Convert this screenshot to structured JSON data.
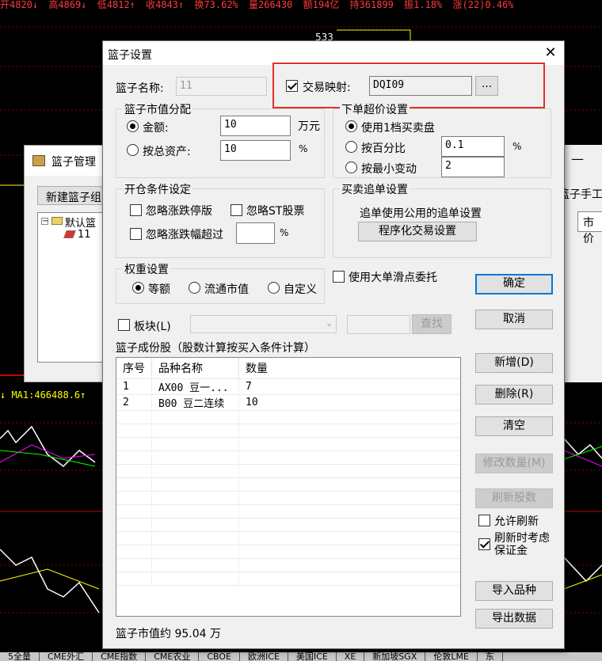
{
  "background": {
    "topbar": [
      "开4820↓",
      "高4869↓",
      "低4812↑",
      "收4843↑",
      "换73.62%",
      "量266430",
      "额194亿",
      "持361899",
      "振1.18%",
      "涨(22)0.46%"
    ],
    "price_label": "533",
    "ma_label": "↓ MA1:466488.6↑",
    "bottom_tabs": [
      "5全量",
      "CME外汇",
      "CME指数",
      "CME农业",
      "CBOE",
      "欧洲ICE",
      "美国ICE",
      "XE",
      "新加坡SGX",
      "伦敦LME",
      "东"
    ]
  },
  "basket_manager": {
    "title": "篮子管理",
    "new_button": "新建篮子组",
    "tree_root": "默认篮",
    "tree_child": "11",
    "right_label": "篮子手工",
    "right_box": "市价"
  },
  "dialog": {
    "title": "篮子设置",
    "name_label": "篮子名称:",
    "name_value": "11",
    "trade_map_label": "交易映射:",
    "trade_map_value": "DQI09",
    "ellipsis": "...",
    "market_value_group": "篮子市值分配",
    "amount_label": "金额:",
    "amount_value": "10",
    "amount_unit": "万元",
    "total_assets_label": "按总资产:",
    "total_assets_value": "10",
    "percent_unit": "%",
    "overprice_group": "下单超价设置",
    "opt_level1": "使用1档买卖盘",
    "opt_percent": "按百分比",
    "opt_percent_value": "0.1",
    "opt_min_tick": "按最小变动",
    "opt_min_tick_value": "2",
    "open_cond_group": "开仓条件设定",
    "ignore_limit": "忽略涨跌停版",
    "ignore_st": "忽略ST股票",
    "ignore_range": "忽略涨跌幅超过",
    "range_unit": "%",
    "chase_group": "买卖追单设置",
    "chase_desc": "追单使用公用的追单设置",
    "program_button": "程序化交易设置",
    "weight_group": "权重设置",
    "weight_equal": "等额",
    "weight_float": "流通市值",
    "weight_custom": "自定义",
    "big_slip": "使用大单滑点委托",
    "ok": "确定",
    "cancel": "取消",
    "sector_label": "板块(L)",
    "search": "查找",
    "components_label": "篮子成份股（股数计算按买入条件计算）",
    "table_headers": [
      "序号",
      "品种名称",
      "数量"
    ],
    "table_rows": [
      [
        "1",
        "AX00 豆一...",
        "7"
      ],
      [
        "2",
        "B00 豆二连续",
        "10"
      ]
    ],
    "add": "新增(D)",
    "delete": "删除(R)",
    "clear": "清空",
    "modify_qty": "修改数量(M)",
    "refresh_stock": "刷新股数",
    "allow_refresh": "允许刷新",
    "refresh_margin": "刷新时考虑保证金",
    "import": "导入品种",
    "export": "导出数据",
    "basket_value": "篮子市值约 95.04 万"
  }
}
